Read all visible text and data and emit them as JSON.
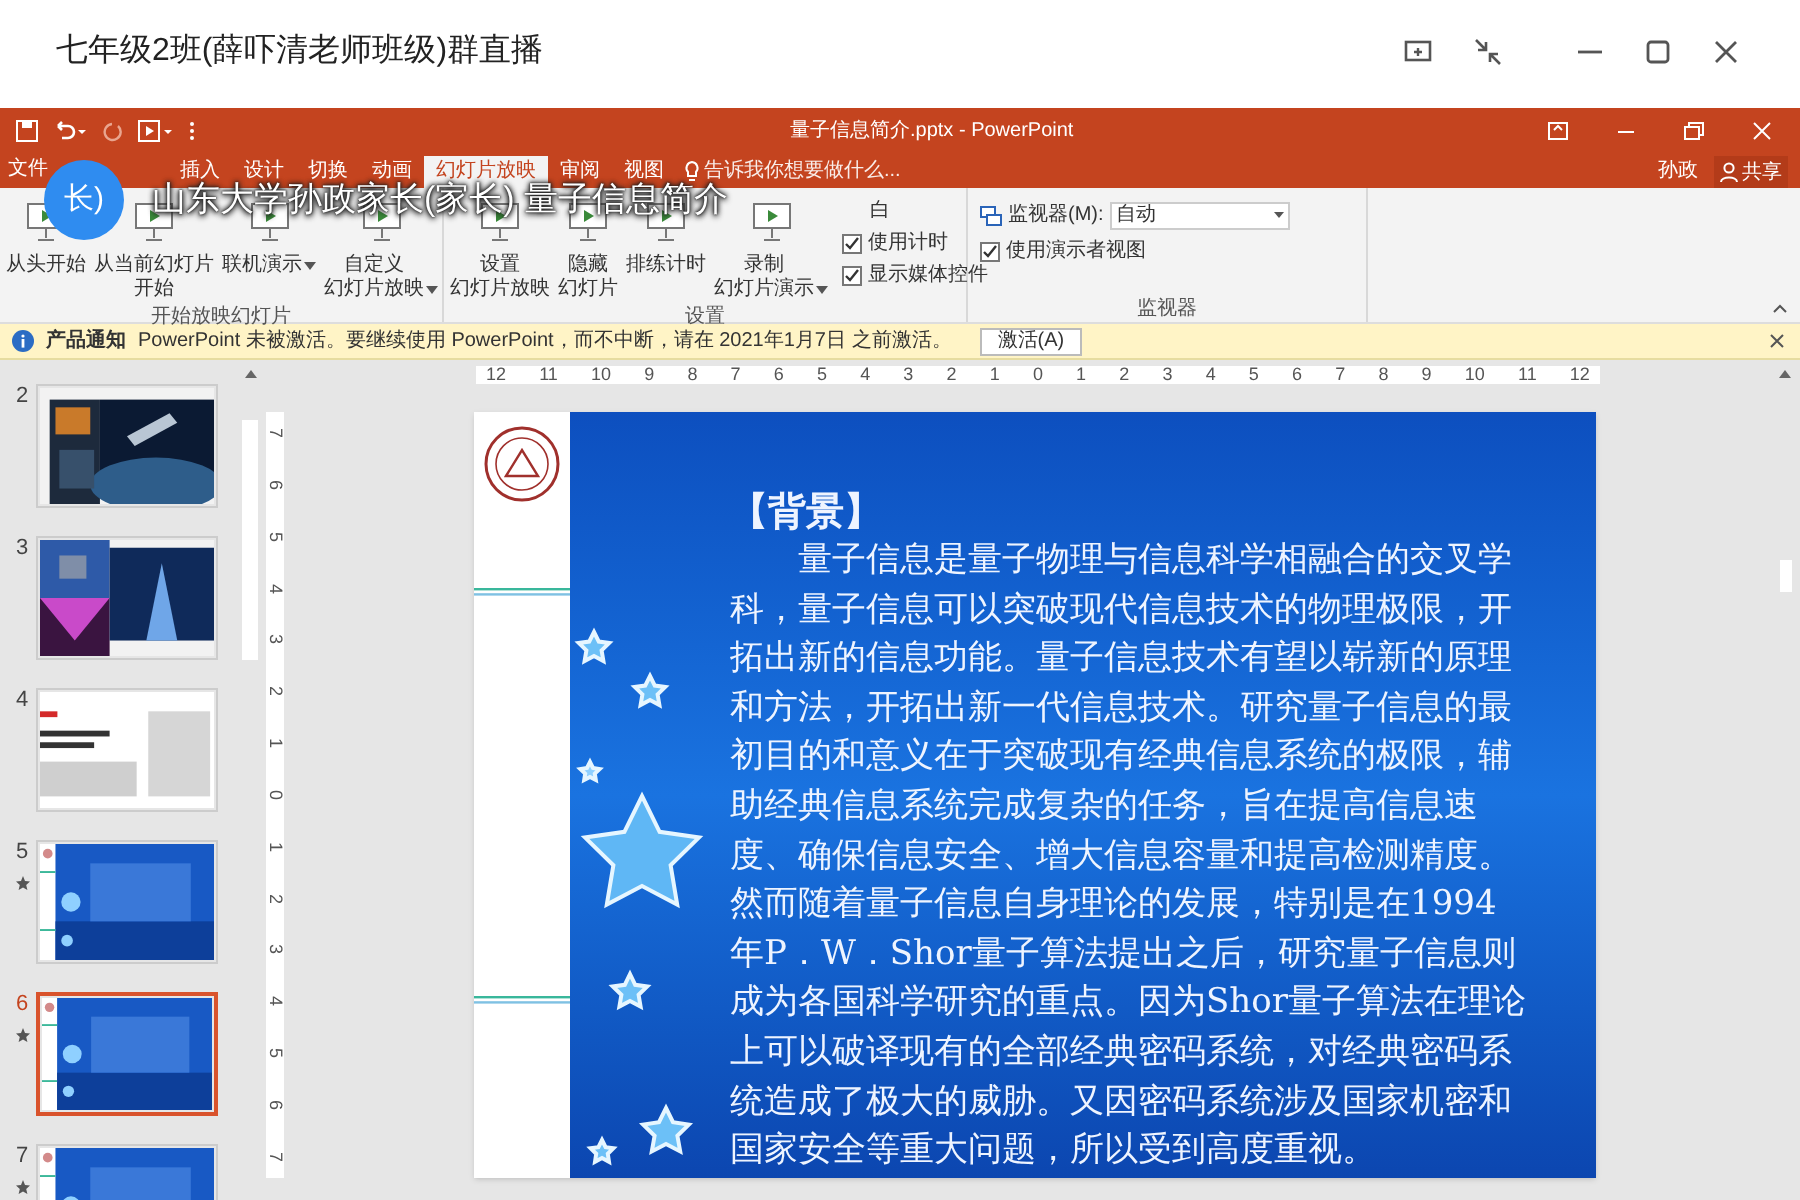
{
  "app_window": {
    "title": "七年级2班(薛吓清老师班级)群直播"
  },
  "powerpoint": {
    "title": "量子信息简介.pptx - PowerPoint",
    "user": "孙政",
    "share": "共享",
    "tabs": [
      {
        "label": "文件",
        "selected": false
      },
      {
        "label": "插入",
        "selected": false
      },
      {
        "label": "设计",
        "selected": false
      },
      {
        "label": "切换",
        "selected": false
      },
      {
        "label": "动画",
        "selected": false
      },
      {
        "label": "幻灯片放映",
        "selected": true
      },
      {
        "label": "审阅",
        "selected": false
      },
      {
        "label": "视图",
        "selected": false
      }
    ],
    "tell_me": "告诉我你想要做什么...",
    "ribbon_groups": [
      {
        "label": "开始放映幻灯片",
        "buttons": [
          {
            "lines": [
              "从头开始"
            ],
            "dropdown": false
          },
          {
            "lines": [
              "从当前幻灯片",
              "开始"
            ],
            "dropdown": false
          },
          {
            "lines": [
              "联机演示"
            ],
            "dropdown": true
          },
          {
            "lines": [
              "自定义",
              "幻灯片放映"
            ],
            "dropdown": true
          }
        ]
      },
      {
        "label": "设置",
        "buttons": [
          {
            "lines": [
              "设置",
              "幻灯片放映"
            ],
            "dropdown": false
          },
          {
            "lines": [
              "隐藏",
              "幻灯片"
            ],
            "dropdown": false
          },
          {
            "lines": [
              "排练计时"
            ],
            "dropdown": false
          },
          {
            "lines": [
              "录制",
              "幻灯片演示"
            ],
            "dropdown": true
          }
        ],
        "checkboxes": [
          {
            "label": "白"
          },
          {
            "label": "使用计时",
            "checked": true
          },
          {
            "label": "显示媒体控件",
            "checked": true
          }
        ]
      },
      {
        "label": "监视器",
        "monitor": {
          "label": "监视器(M):",
          "value": "自动"
        },
        "checkboxes": [
          {
            "label": "使用演示者视图",
            "checked": true
          }
        ]
      }
    ],
    "notification": {
      "title": "产品通知",
      "message": "PowerPoint 未被激活。要继续使用 PowerPoint，而不中断，请在 2021年1月7日 之前激活。",
      "button": "激活(A)"
    },
    "thumbnails": [
      {
        "number": "2",
        "selected": false,
        "animated": false
      },
      {
        "number": "3",
        "selected": false,
        "animated": false
      },
      {
        "number": "4",
        "selected": false,
        "animated": false
      },
      {
        "number": "5",
        "selected": false,
        "animated": true
      },
      {
        "number": "6",
        "selected": true,
        "animated": true
      },
      {
        "number": "7",
        "selected": false,
        "animated": true
      }
    ],
    "horizontal_ruler": [
      "12",
      "11",
      "10",
      "9",
      "8",
      "7",
      "6",
      "5",
      "4",
      "3",
      "2",
      "1",
      "0",
      "1",
      "2",
      "3",
      "4",
      "5",
      "6",
      "7",
      "8",
      "9",
      "10",
      "11",
      "12"
    ],
    "vertical_ruler": [
      "7",
      "6",
      "5",
      "4",
      "3",
      "2",
      "1",
      "0",
      "1",
      "2",
      "3",
      "4",
      "5",
      "6",
      "7"
    ],
    "slide": {
      "heading": "【背景】",
      "body": "量子信息是量子物理与信息科学相融合的交叉学科，量子信息可以突破现代信息技术的物理极限，开拓出新的信息功能。量子信息技术有望以崭新的原理和方法，开拓出新一代信息技术。研究量子信息的最初目的和意义在于突破现有经典信息系统的极限，辅助经典信息系统完成复杂的任务，旨在提高信息速度、确保信息安全、增大信息容量和提高检测精度。然而随着量子信息自身理论的发展，特别是在1994年P．W．Shor量子算法提出之后，研究量子信息则成为各国科学研究的重点。因为Shor量子算法在理论上可以破译现有的全部经典密码系统，对经典密码系统造成了极大的威胁。又因密码系统涉及国家机密和国家安全等重大问题，所以受到高度重视。"
    }
  },
  "stream_overlay": {
    "avatar": "长)",
    "caption": "山东大学孙政家长(家长) 量子信息简介"
  }
}
